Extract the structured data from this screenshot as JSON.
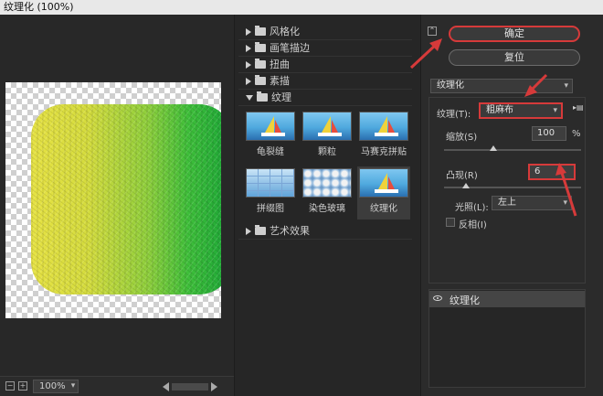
{
  "window": {
    "title": "纹理化 (100%)"
  },
  "preview": {
    "zoom": "100%"
  },
  "gallery": {
    "categories": [
      {
        "label": "风格化",
        "open": false
      },
      {
        "label": "画笔描边",
        "open": false
      },
      {
        "label": "扭曲",
        "open": false
      },
      {
        "label": "素描",
        "open": false
      },
      {
        "label": "纹理",
        "open": true
      },
      {
        "label": "艺术效果",
        "open": false
      }
    ],
    "texture_filters": [
      "龟裂缝",
      "颗粒",
      "马赛克拼贴",
      "拼缀图",
      "染色玻璃",
      "纹理化"
    ],
    "selected_filter": "纹理化"
  },
  "options": {
    "collapse_symbol": "⌃",
    "ok_label": "确定",
    "reset_label": "复位",
    "filter_select": "纹理化",
    "texture_label": "纹理(T):",
    "texture_value": "粗麻布",
    "scaling_label": "缩放(S)",
    "scaling_value": "100",
    "scaling_unit": "%",
    "relief_label": "凸现(R)",
    "relief_value": "6",
    "light_label": "光照(L):",
    "light_value": "左上",
    "invert_label": "反相(I)",
    "invert_checked": false
  },
  "layers": {
    "items": [
      "纹理化"
    ]
  },
  "colors": {
    "accent_red": "#d63a3a",
    "gradient_start": "#e6e244",
    "gradient_end": "#1aa637"
  },
  "icons": [
    "folder-icon",
    "disclosure-triangle-icon",
    "eye-icon",
    "panel-menu-icon"
  ]
}
